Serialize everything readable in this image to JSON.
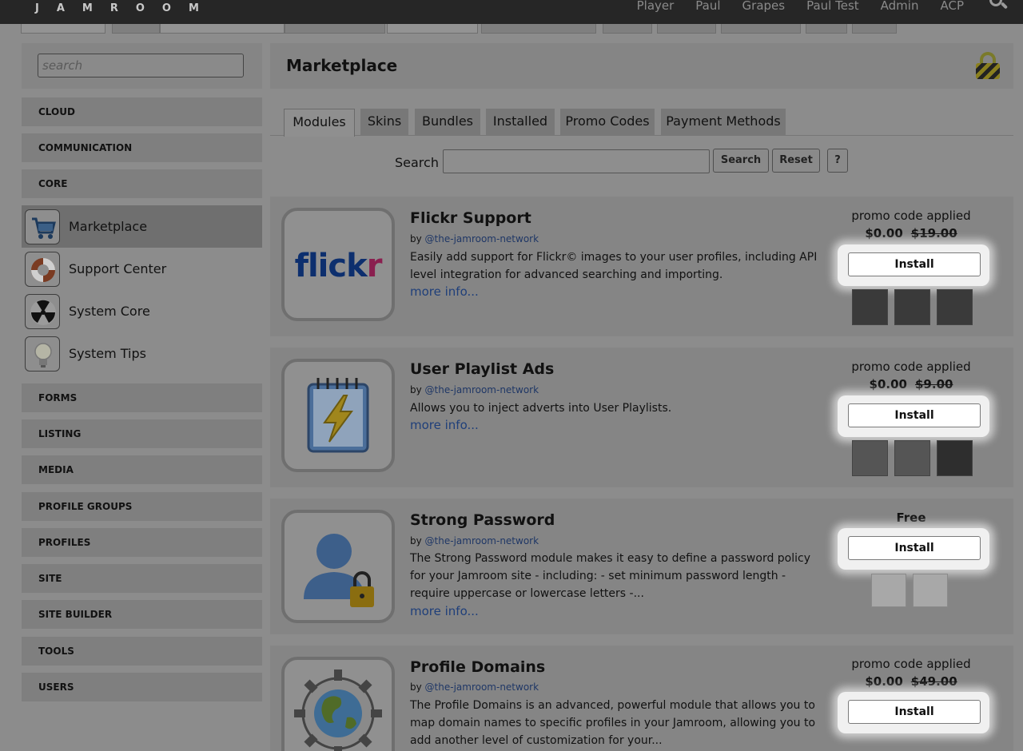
{
  "header": {
    "logo_text": "JAMROOM",
    "nav": [
      "Player",
      "Paul",
      "Grapes",
      "Paul Test",
      "Admin",
      "ACP"
    ]
  },
  "sidebar": {
    "search_placeholder": "search",
    "categories_top": [
      "CLOUD",
      "COMMUNICATION",
      "CORE"
    ],
    "modules": [
      {
        "label": "Marketplace",
        "icon": "cart-icon"
      },
      {
        "label": "Support Center",
        "icon": "lifebuoy-icon"
      },
      {
        "label": "System Core",
        "icon": "radiation-icon"
      },
      {
        "label": "System Tips",
        "icon": "lightbulb-icon"
      }
    ],
    "categories_bottom": [
      "FORMS",
      "LISTING",
      "MEDIA",
      "PROFILE GROUPS",
      "PROFILES",
      "SITE",
      "SITE BUILDER",
      "TOOLS",
      "USERS"
    ]
  },
  "main": {
    "title": "Marketplace",
    "tabs": [
      "Modules",
      "Skins",
      "Bundles",
      "Installed",
      "Promo Codes",
      "Payment Methods"
    ],
    "search_label": "Search",
    "search_button": "Search",
    "reset_button": "Reset",
    "help_button": "?"
  },
  "items": [
    {
      "title": "Flickr Support",
      "by": "by",
      "author": "@the-jamroom-network",
      "description": "Easily add support for Flickr© images to your user profiles, including API level integration for advanced searching and importing.",
      "more": "more info...",
      "promo": "promo code applied",
      "price": "$0.00",
      "old_price": "$19.00",
      "install": "Install",
      "icon": "flickr-logo",
      "icon_text": "flickr"
    },
    {
      "title": "User Playlist Ads",
      "by": "by",
      "author": "@the-jamroom-network",
      "description": "Allows you to inject adverts into User Playlists.",
      "more": "more info...",
      "promo": "promo code applied",
      "price": "$0.00",
      "old_price": "$9.00",
      "install": "Install",
      "icon": "notepad-lightning-icon"
    },
    {
      "title": "Strong Password",
      "by": "by",
      "author": "@the-jamroom-network",
      "description": "The Strong Password module makes it easy to define a password policy for your Jamroom site - including: - set minimum password length - require uppercase or lowercase letters -...",
      "more": "more info...",
      "price": "Free",
      "install": "Install",
      "icon": "user-lock-icon"
    },
    {
      "title": "Profile Domains",
      "by": "by",
      "author": "@the-jamroom-network",
      "description": "The Profile Domains is an advanced, powerful module that allows you to map domain names to specific profiles in your Jamroom, allowing you to add another level of customization for your...",
      "more": "more info...",
      "promo": "promo code applied",
      "price": "$0.00",
      "old_price": "$49.00",
      "install": "Install",
      "icon": "globe-gear-icon"
    }
  ]
}
